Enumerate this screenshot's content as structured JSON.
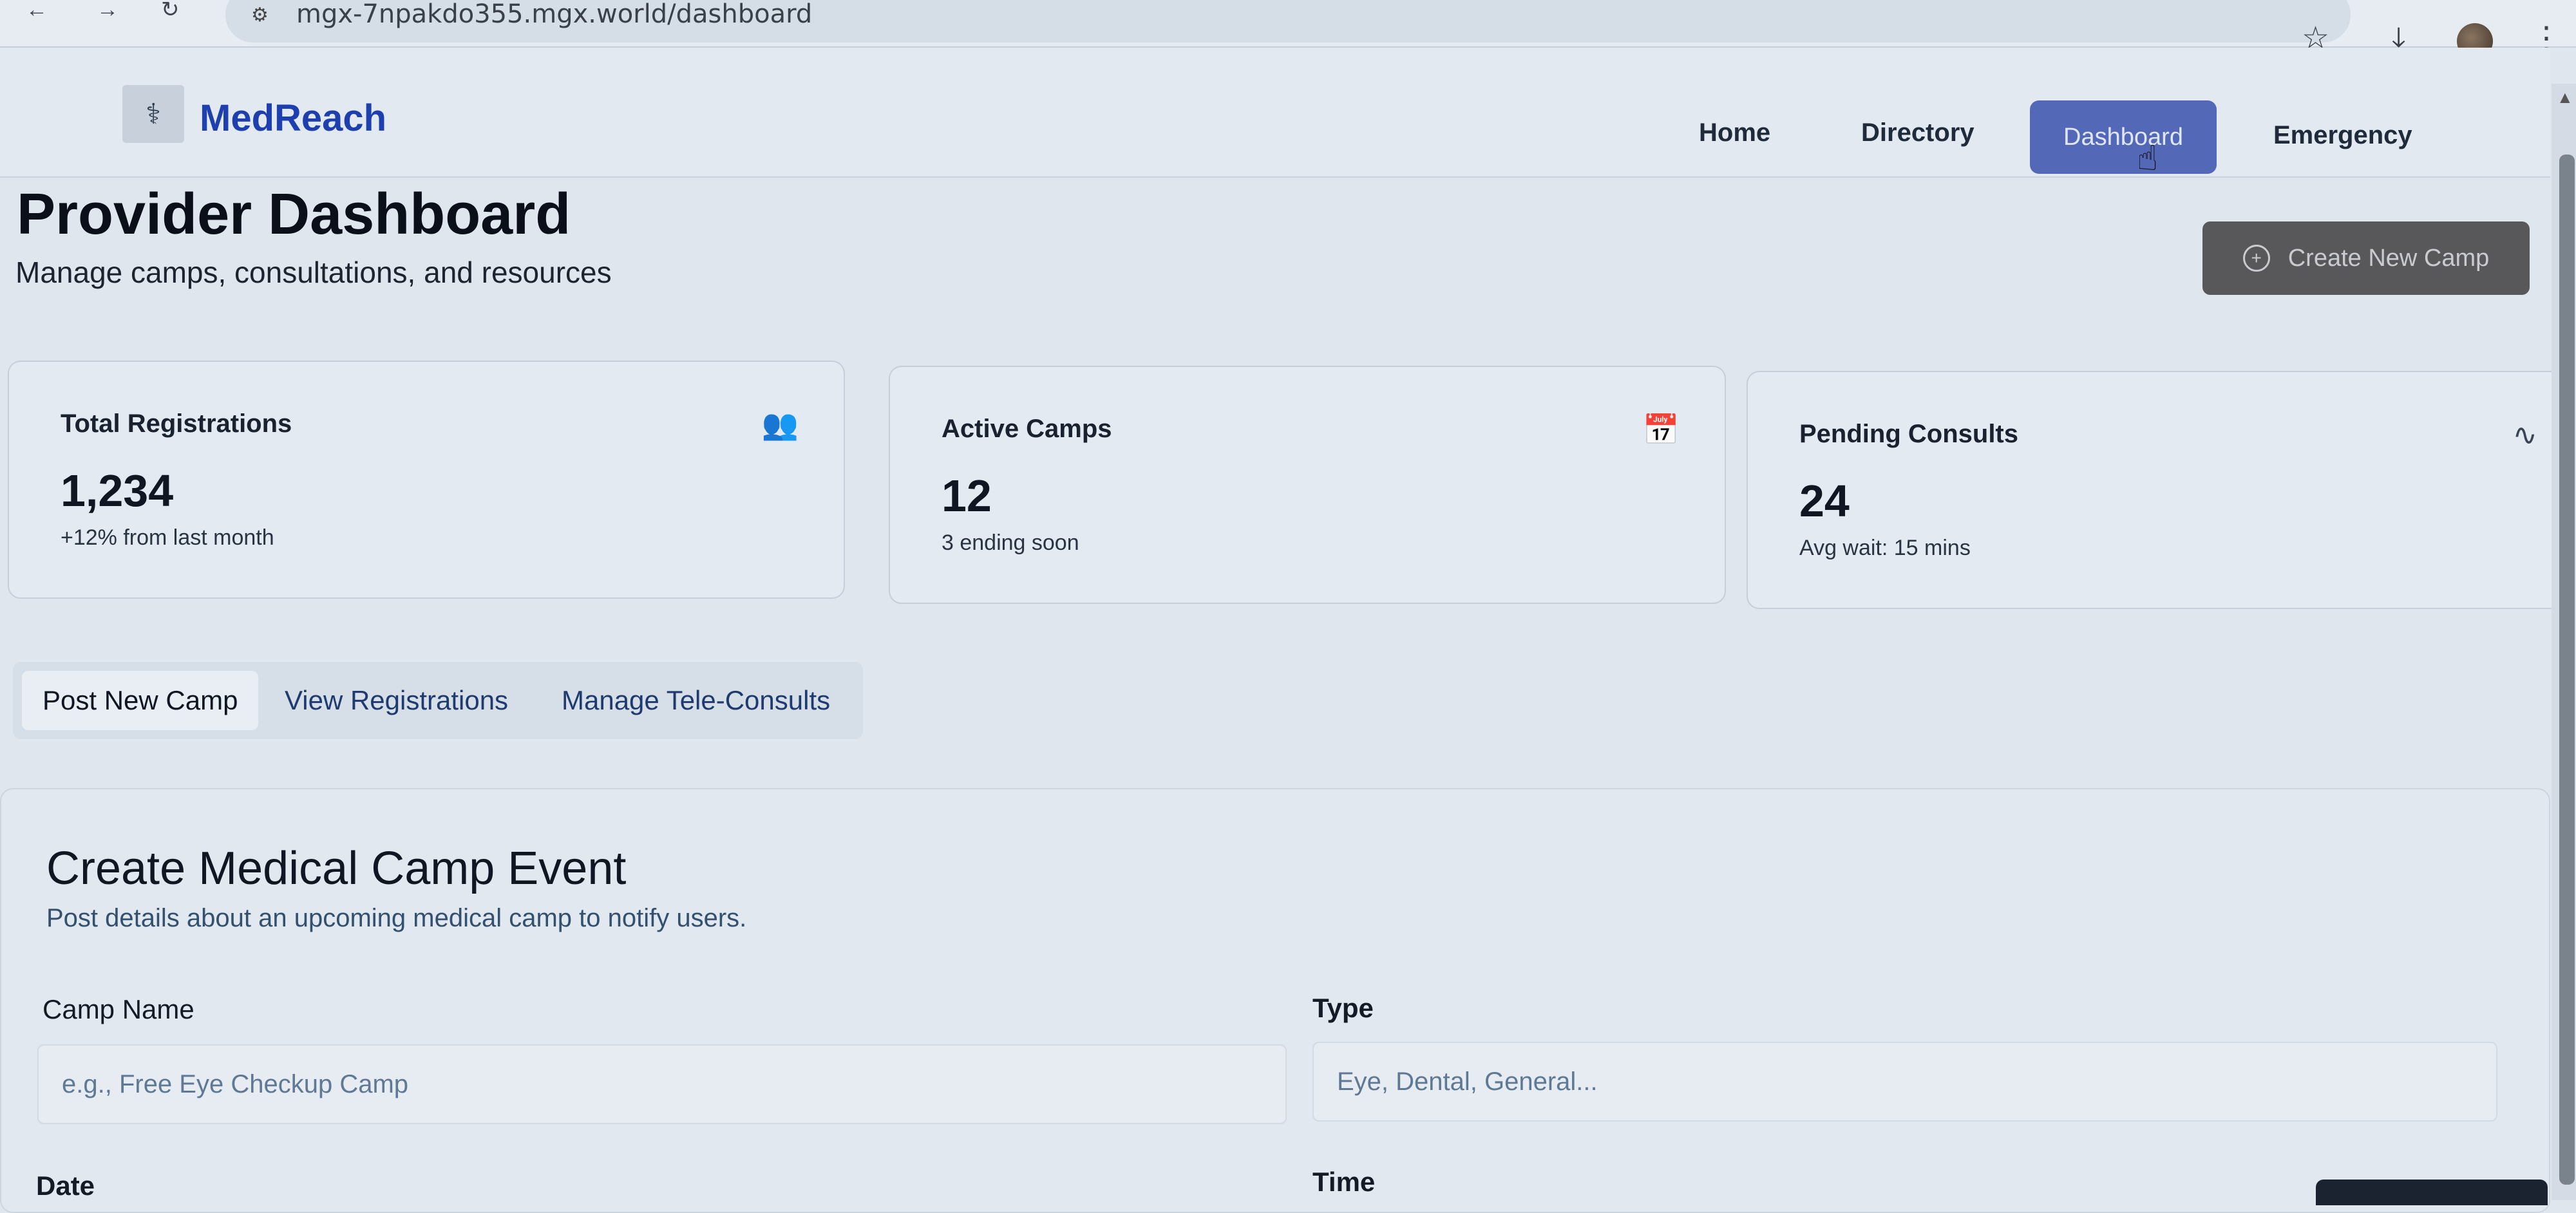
{
  "browser": {
    "url": "mgx-7npakdo355.mgx.world/dashboard",
    "lock_icon": "site-info-icon",
    "back_icon": "arrow-left-icon",
    "forward_icon": "arrow-right-icon",
    "reload_icon": "reload-icon",
    "bookmark_icon": "star-icon",
    "download_icon": "download-icon",
    "menu_icon": "kebab-menu-icon"
  },
  "header": {
    "brand": "MedReach",
    "logo_icon": "stethoscope-logo-icon",
    "nav": [
      {
        "label": "Home",
        "active": false
      },
      {
        "label": "Directory",
        "active": false
      },
      {
        "label": "Dashboard",
        "active": true
      },
      {
        "label": "Emergency",
        "active": false
      }
    ]
  },
  "page": {
    "title": "Provider Dashboard",
    "subtitle": "Manage camps, consultations, and resources",
    "create_button": "Create New Camp",
    "create_icon": "plus-circle-icon"
  },
  "stats": [
    {
      "label": "Total Registrations",
      "value": "1,234",
      "note": "+12% from last month",
      "icon": "users-icon"
    },
    {
      "label": "Active Camps",
      "value": "12",
      "note": "3 ending soon",
      "icon": "calendar-icon"
    },
    {
      "label": "Pending Consults",
      "value": "24",
      "note": "Avg wait: 15 mins",
      "icon": "activity-icon"
    }
  ],
  "tabs": [
    {
      "label": "Post New Camp",
      "active": true
    },
    {
      "label": "View Registrations",
      "active": false
    },
    {
      "label": "Manage Tele-Consults",
      "active": false
    }
  ],
  "form": {
    "title": "Create Medical Camp Event",
    "description": "Post details about an upcoming medical camp to notify users.",
    "camp_name_label": "Camp Name",
    "camp_name_placeholder": "e.g., Free Eye Checkup Camp",
    "type_label": "Type",
    "type_placeholder": "Eye, Dental, General...",
    "date_label": "Date",
    "time_label": "Time"
  },
  "colors": {
    "brand": "#1e40af",
    "nav_active": "#5468b8",
    "create_button": "#58585a"
  }
}
